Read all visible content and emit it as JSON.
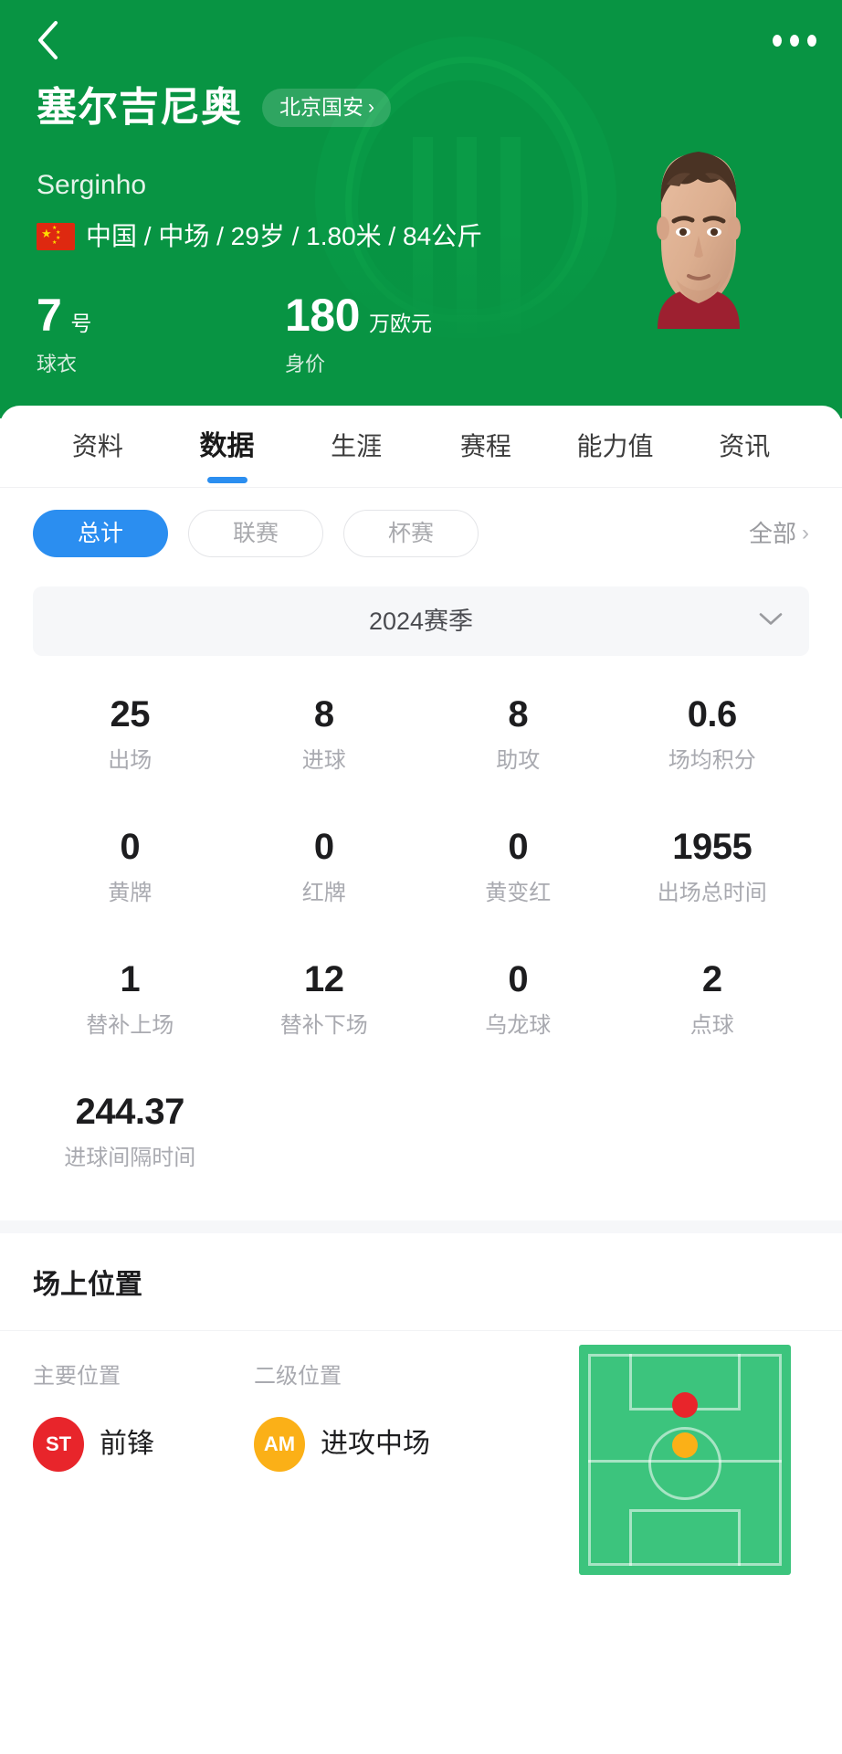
{
  "nav": {
    "back_icon": "chevron-left-icon",
    "more_icon": "more-horizontal-icon"
  },
  "header": {
    "player_name_cn": "塞尔吉尼奥",
    "player_name_en": "Serginho",
    "team_name": "北京国安",
    "team_chevron": "›",
    "nationality": "中国",
    "meta_line": "中国 / 中场 / 29岁 / 1.80米 / 84公斤",
    "position_short": "中场",
    "age": "29岁",
    "height": "1.80米",
    "weight": "84公斤",
    "kpis": [
      {
        "num": "7",
        "unit": "号",
        "label": "球衣"
      },
      {
        "num": "180",
        "unit": "万欧元",
        "label": "身价"
      }
    ],
    "bg_color": "#089443"
  },
  "tabs": [
    {
      "label": "资料",
      "active": false
    },
    {
      "label": "数据",
      "active": true
    },
    {
      "label": "生涯",
      "active": false
    },
    {
      "label": "赛程",
      "active": false
    },
    {
      "label": "能力值",
      "active": false
    },
    {
      "label": "资讯",
      "active": false
    }
  ],
  "filters": {
    "chips": [
      {
        "label": "总计",
        "selected": true
      },
      {
        "label": "联赛",
        "selected": false
      },
      {
        "label": "杯赛",
        "selected": false
      }
    ],
    "all_label": "全部",
    "all_chevron": "›",
    "accent_color": "#2b8ef0"
  },
  "season": {
    "label": "2024赛季",
    "chevron_icon": "chevron-down-icon"
  },
  "stats": [
    {
      "value": "25",
      "label": "出场"
    },
    {
      "value": "8",
      "label": "进球"
    },
    {
      "value": "8",
      "label": "助攻"
    },
    {
      "value": "0.6",
      "label": "场均积分"
    },
    {
      "value": "0",
      "label": "黄牌"
    },
    {
      "value": "0",
      "label": "红牌"
    },
    {
      "value": "0",
      "label": "黄变红"
    },
    {
      "value": "1955",
      "label": "出场总时间"
    },
    {
      "value": "1",
      "label": "替补上场"
    },
    {
      "value": "12",
      "label": "替补下场"
    },
    {
      "value": "0",
      "label": "乌龙球"
    },
    {
      "value": "2",
      "label": "点球"
    },
    {
      "value": "244.37",
      "label": "进球间隔时间"
    },
    {
      "value": "",
      "label": ""
    },
    {
      "value": "",
      "label": ""
    },
    {
      "value": "",
      "label": ""
    }
  ],
  "position_section": {
    "title": "场上位置",
    "primary": {
      "col_title": "主要位置",
      "code": "ST",
      "name": "前锋",
      "color": "#e8252b"
    },
    "secondary": {
      "col_title": "二级位置",
      "code": "AM",
      "name": "进攻中场",
      "color": "#fbb017"
    },
    "pitch": {
      "field_color": "#3cc47d",
      "primary_dot_color": "#e8252b",
      "secondary_dot_color": "#fbb017"
    }
  }
}
